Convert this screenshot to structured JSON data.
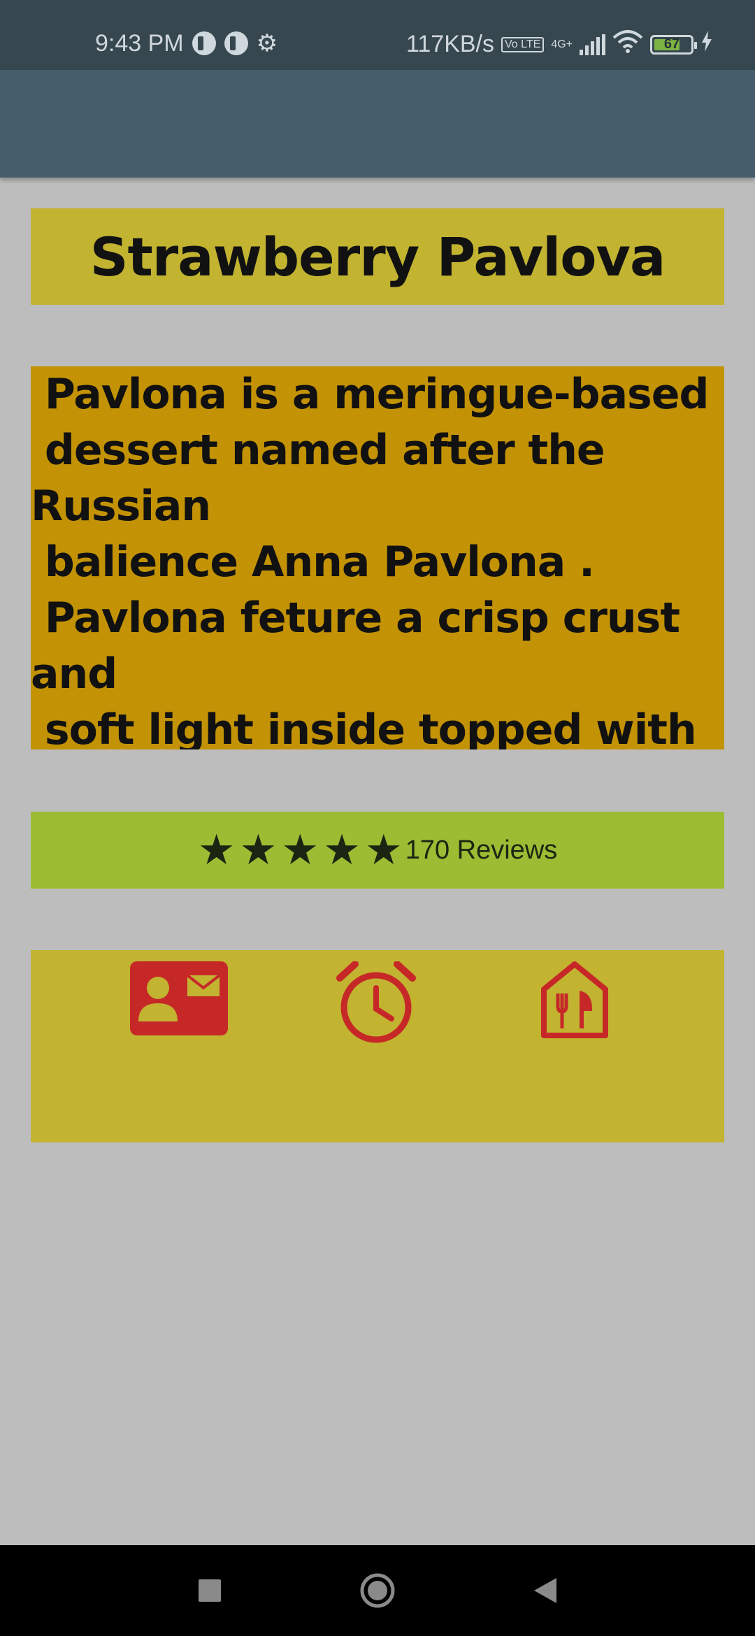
{
  "status_bar": {
    "time": "9:43 PM",
    "net_speed": "117KB/s",
    "volte": "Vo LTE",
    "network": "4G+",
    "battery_level": "67",
    "icons": [
      "app-notification-icon",
      "app-notification-icon",
      "settings-gear-icon",
      "volte-icon",
      "signal-icon",
      "wifi-icon",
      "battery-icon",
      "charging-icon"
    ]
  },
  "recipe": {
    "title": "Strawberry Pavlova",
    "description": " Pavlona is a meringue-based\n dessert named after the\nRussian\n balience Anna Pavlona .\n Pavlona feture a crisp crust\nand\n soft light inside topped with",
    "rating_stars": 5,
    "reviews": "170 Reviews"
  },
  "actions": {
    "icons": [
      "contact-card-icon",
      "alarm-clock-icon",
      "restaurant-house-icon"
    ],
    "icon_color": "#c62828"
  },
  "colors": {
    "background": "#bdbdbd",
    "status_bar": "#37474f",
    "app_bar": "#465e6a",
    "title_box": "#c2b331",
    "desc_box": "#c39205",
    "rating_box": "#9cbc34"
  }
}
